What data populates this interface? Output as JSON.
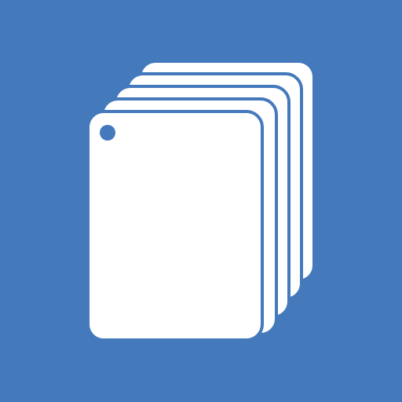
{
  "icon": {
    "name": "stacked-cards-icon",
    "background_color": "#4479BC",
    "card_color": "#FFFFFF",
    "card_count": 5
  }
}
